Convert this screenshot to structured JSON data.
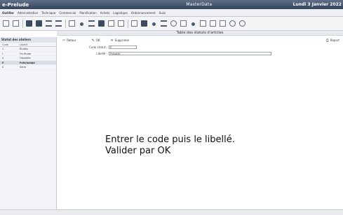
{
  "titlebar": {
    "app_title": "e-Prelude",
    "module_title": "MasterData",
    "date": "Lundi 3 Janvier 2022"
  },
  "menu": [
    "Outiller",
    "Administration",
    "Technique",
    "Commercial",
    "Planification",
    "Achats",
    "Logistique",
    "Ordonnancement",
    "Suivi"
  ],
  "toolbar_icons": [
    "new-icon",
    "print-icon",
    "save-icon",
    "edit-icon",
    "list-icon",
    "filter-icon",
    "grid-icon",
    "record-icon",
    "menu-icon",
    "chart-icon",
    "settings-icon",
    "stop-icon",
    "window-icon",
    "tag-icon",
    "info-icon",
    "table-icon",
    "search-icon",
    "tools-icon",
    "alert-icon",
    "signature-icon",
    "copy-icon",
    "print-preview-icon",
    "help-icon",
    "pin-icon"
  ],
  "page_title": "Table des statuts d'articles",
  "sidebar": {
    "title": "Statut des ateliers",
    "col_code": "Code",
    "col_label": "Libellé",
    "rows": [
      {
        "code": "1",
        "label": "Études"
      },
      {
        "code": "I",
        "label": "Fin étude"
      },
      {
        "code": "4",
        "label": "Obsolète"
      },
      {
        "code": "P",
        "label": "Prêt/Validé"
      },
      {
        "code": "S",
        "label": "Série"
      }
    ],
    "selected_index": 3
  },
  "actions": {
    "back": "Retour",
    "ok": "OK",
    "delete": "Supprimer",
    "report": "Report"
  },
  "form": {
    "code_label": "Code statut :",
    "code_value": "P",
    "label_label": "Libellé :",
    "label_value": "Préparée"
  },
  "help_text": "Entrer le code puis le libellé. Valider par OK"
}
